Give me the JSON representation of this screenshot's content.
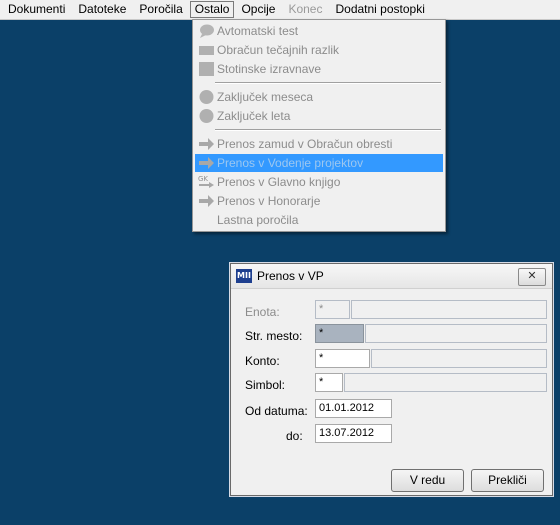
{
  "menubar": {
    "items": [
      {
        "label": "Dokumenti"
      },
      {
        "label": "Datoteke"
      },
      {
        "label": "Poročila"
      },
      {
        "label": "Ostalo"
      },
      {
        "label": "Opcije"
      },
      {
        "label": "Konec"
      },
      {
        "label": "Dodatni postopki"
      }
    ]
  },
  "dropdown": {
    "items": [
      {
        "label": "Avtomatski test",
        "icon": "speech-bubble-icon"
      },
      {
        "label": "Obračun tečajnih razlik",
        "icon": "grid-icon"
      },
      {
        "label": "Stotinske izravnave",
        "icon": "grid-icon"
      },
      {
        "label": "Zaključek meseca",
        "icon": "calendar-icon"
      },
      {
        "label": "Zaključek leta",
        "icon": "calendar-icon"
      },
      {
        "label": "Prenos zamud v Obračun obresti",
        "icon": "arrow-right-icon"
      },
      {
        "label": "Prenos v Vodenje projektov",
        "icon": "arrow-right-icon"
      },
      {
        "label": "Prenos v Glavno knjigo",
        "icon": "ok-arrow-icon"
      },
      {
        "label": "Prenos v Honorarje",
        "icon": "arrow-right-icon"
      },
      {
        "label": "Lastna poročila",
        "icon": ""
      }
    ]
  },
  "dialog": {
    "title": "Prenos v VP",
    "close_glyph": "✕",
    "app_icon_text": "MII",
    "fields": {
      "enota": {
        "label": "Enota:",
        "value": "*"
      },
      "str_mesto": {
        "label": "Str. mesto:",
        "value": "*"
      },
      "konto": {
        "label": "Konto:",
        "value": "*"
      },
      "simbol": {
        "label": "Simbol:",
        "value": "*"
      },
      "od_datuma": {
        "label": "Od datuma:",
        "value": "01.01.2012"
      },
      "do": {
        "label": "do:",
        "value": "13.07.2012"
      }
    },
    "ok_label": "V redu",
    "cancel_label": "Prekliči"
  },
  "colors": {
    "desktop": "#0b4068",
    "highlight": "#3399ff",
    "disabled_text": "#8c8c8c"
  }
}
